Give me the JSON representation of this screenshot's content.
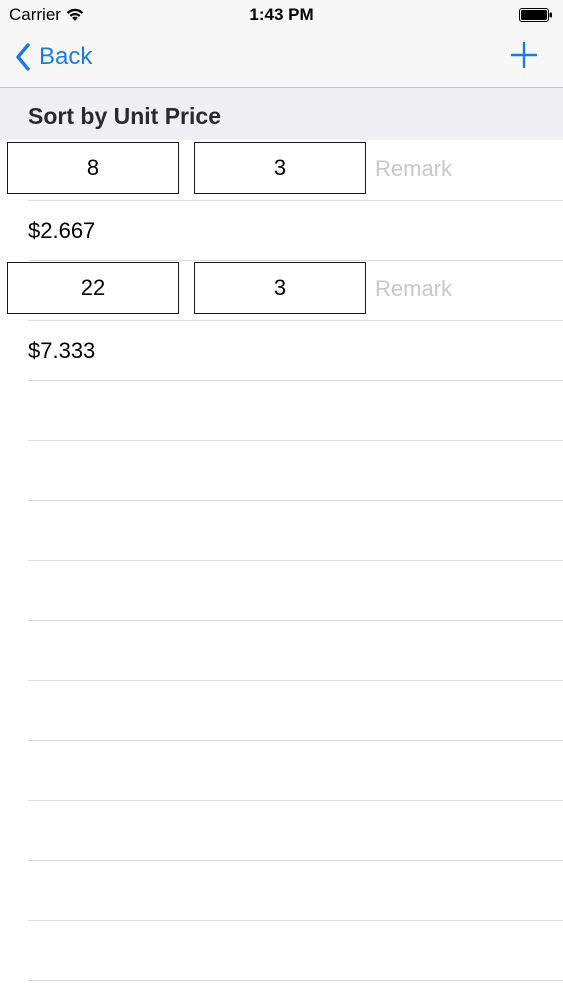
{
  "status_bar": {
    "carrier": "Carrier",
    "time": "1:43 PM",
    "wifi_icon": "wifi-icon",
    "battery_icon": "battery-full-icon"
  },
  "nav": {
    "back_label": "Back",
    "back_icon": "chevron-left-icon",
    "add_icon": "plus-icon"
  },
  "section": {
    "title": "Sort by Unit Price"
  },
  "items": [
    {
      "price": "8",
      "quantity": "3",
      "remark_placeholder": "Remark",
      "unit_price": "$2.667"
    },
    {
      "price": "22",
      "quantity": "3",
      "remark_placeholder": "Remark",
      "unit_price": "$7.333"
    }
  ],
  "colors": {
    "accent": "#1f7ae0",
    "nav_background": "#f7f7f7",
    "section_background": "#efeff4",
    "placeholder": "#c7c7cd"
  }
}
